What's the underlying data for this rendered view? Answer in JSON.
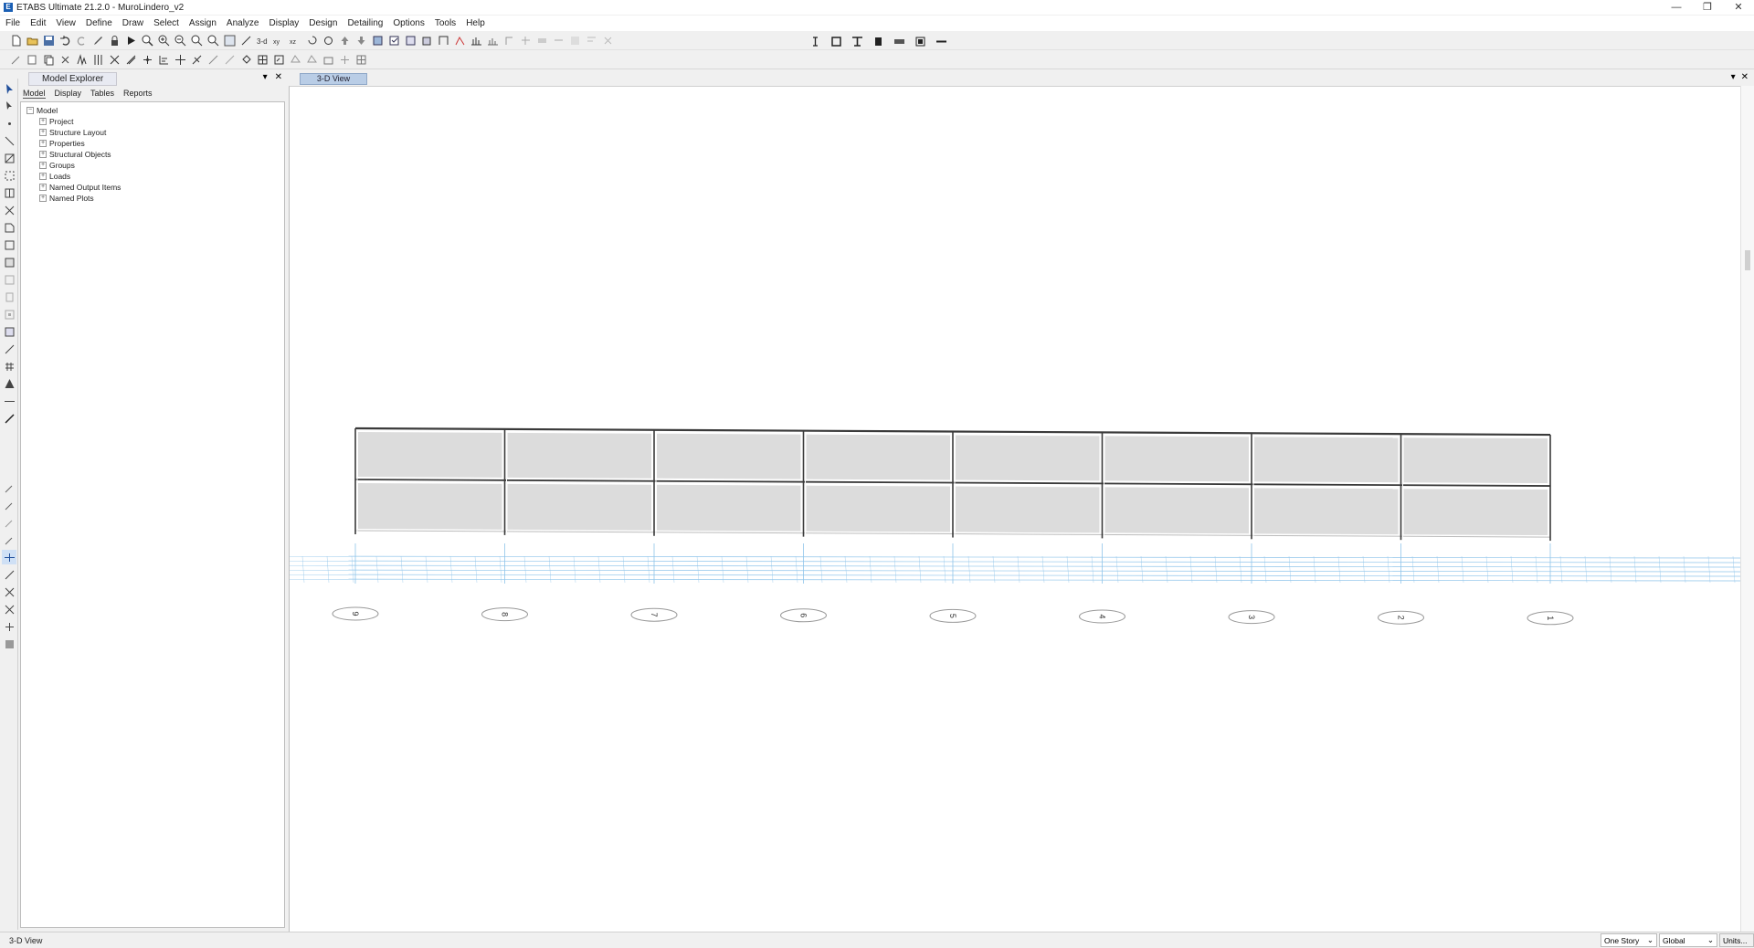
{
  "window": {
    "title": "ETABS Ultimate 21.2.0 - MuroLindero_v2",
    "app_icon": "E",
    "controls": [
      "—",
      "❐",
      "✕"
    ]
  },
  "menu": [
    "File",
    "Edit",
    "View",
    "Define",
    "Draw",
    "Select",
    "Assign",
    "Analyze",
    "Display",
    "Design",
    "Detailing",
    "Options",
    "Tools",
    "Help"
  ],
  "model_explorer": {
    "title": "Model Explorer",
    "tabs": [
      "Model",
      "Display",
      "Tables",
      "Reports"
    ],
    "root": "Model",
    "items": [
      "Project",
      "Structure Layout",
      "Properties",
      "Structural Objects",
      "Groups",
      "Loads",
      "Named Output Items",
      "Named Plots"
    ]
  },
  "viewport": {
    "tab": "3-D View",
    "grid_labels": [
      "9",
      "8",
      "7",
      "6",
      "5",
      "4",
      "3",
      "2",
      "1"
    ]
  },
  "status": {
    "left": "3-D View",
    "story_mode": "One Story",
    "coord_system": "Global",
    "units_button": "Units..."
  },
  "colors": {
    "wall_fill": "#dcdcdc",
    "frame_line": "#3a3a3a",
    "grid_line": "#8fc4ea",
    "tab_active": "#b9cde6"
  }
}
